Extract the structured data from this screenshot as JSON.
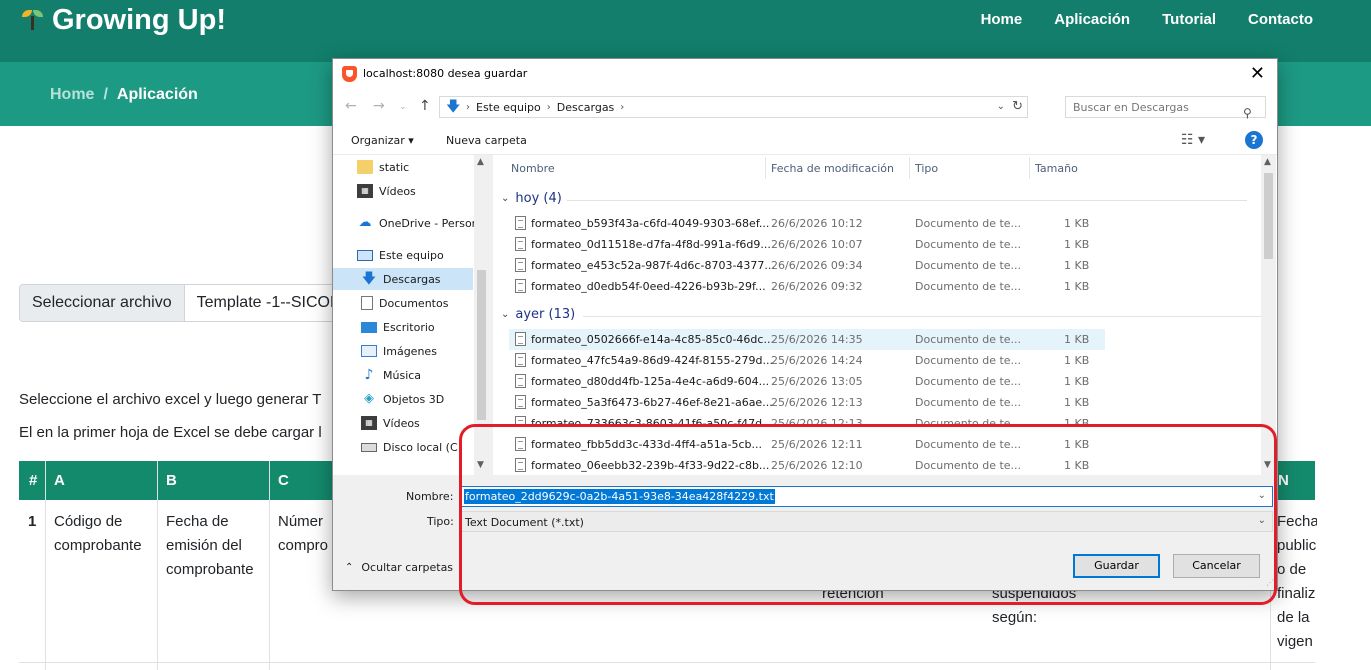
{
  "site": {
    "brand": "Growing Up!",
    "nav": [
      "Home",
      "Aplicación",
      "Tutorial",
      "Contacto"
    ],
    "breadcrumb": {
      "home": "Home",
      "separator": "/",
      "current": "Aplicación"
    },
    "file_input": {
      "button": "Seleccionar archivo",
      "filename": "Template -1--SICOR"
    },
    "instructions": [
      "Seleccione el archivo excel y luego generar T",
      "El en la primer hoja de Excel se debe cargar l"
    ],
    "table": {
      "headers": [
        "#",
        "A",
        "B",
        "C",
        "N"
      ],
      "row_number": "1",
      "cells": {
        "a": "Código de\ncomprobante",
        "b": "Fecha de\nemisión del\ncomprobante",
        "c": "Númer\ncompro",
        "retention": "retención",
        "suspended": "suspendidos\nsegún:",
        "n": "Fecha\npublic\no de\nfinaliz\nde la\nvigen"
      }
    }
  },
  "dialog": {
    "title": "localhost:8080 desea guardar",
    "address": [
      "Este equipo",
      "Descargas"
    ],
    "search_placeholder": "Buscar en Descargas",
    "toolbar": {
      "organize": "Organizar ▾",
      "new_folder": "Nueva carpeta"
    },
    "nav_items": [
      {
        "label": "static",
        "icon": "folder-icon"
      },
      {
        "label": "Vídeos",
        "icon": "videos-icon"
      },
      {
        "label": "OneDrive - Person",
        "icon": "onedrive-icon"
      },
      {
        "label": "Este equipo",
        "icon": "computer-icon"
      },
      {
        "label": "Descargas",
        "icon": "downloads-icon"
      },
      {
        "label": "Documentos",
        "icon": "documents-icon"
      },
      {
        "label": "Escritorio",
        "icon": "desktop-icon"
      },
      {
        "label": "Imágenes",
        "icon": "pictures-icon"
      },
      {
        "label": "Música",
        "icon": "music-icon"
      },
      {
        "label": "Objetos 3D",
        "icon": "objects3d-icon"
      },
      {
        "label": "Vídeos",
        "icon": "videos-icon"
      },
      {
        "label": "Disco local (C",
        "icon": "drive-icon"
      }
    ],
    "columns": [
      "Nombre",
      "Fecha de modificación",
      "Tipo",
      "Tamaño"
    ],
    "groups": [
      {
        "label": "hoy (4)",
        "files": [
          {
            "name": "formateo_b593f43a-c6fd-4049-9303-68ef...",
            "date": "26/6/2026 10:12",
            "type": "Documento de te...",
            "size": "1 KB"
          },
          {
            "name": "formateo_0d11518e-d7fa-4f8d-991a-f6d9...",
            "date": "26/6/2026 10:07",
            "type": "Documento de te...",
            "size": "1 KB"
          },
          {
            "name": "formateo_e453c52a-987f-4d6c-8703-4377...",
            "date": "26/6/2026 09:34",
            "type": "Documento de te...",
            "size": "1 KB"
          },
          {
            "name": "formateo_d0edb54f-0eed-4226-b93b-29f...",
            "date": "26/6/2026 09:32",
            "type": "Documento de te...",
            "size": "1 KB"
          }
        ]
      },
      {
        "label": "ayer (13)",
        "files": [
          {
            "name": "formateo_0502666f-e14a-4c85-85c0-46dc...",
            "date": "25/6/2026 14:35",
            "type": "Documento de te...",
            "size": "1 KB"
          },
          {
            "name": "formateo_47fc54a9-86d9-424f-8155-279d...",
            "date": "25/6/2026 14:24",
            "type": "Documento de te...",
            "size": "1 KB"
          },
          {
            "name": "formateo_d80dd4fb-125a-4e4c-a6d9-604...",
            "date": "25/6/2026 13:05",
            "type": "Documento de te...",
            "size": "1 KB"
          },
          {
            "name": "formateo_5a3f6473-6b27-46ef-8e21-a6ae...",
            "date": "25/6/2026 12:13",
            "type": "Documento de te...",
            "size": "1 KB"
          },
          {
            "name": "formateo_733663c3-8603-41f6-a50c-f47d...",
            "date": "25/6/2026 12:13",
            "type": "Documento de te...",
            "size": "1 KB"
          },
          {
            "name": "formateo_fbb5dd3c-433d-4ff4-a51a-5cb...",
            "date": "25/6/2026 12:11",
            "type": "Documento de te...",
            "size": "1 KB"
          },
          {
            "name": "formateo_06eebb32-239b-4f33-9d22-c8b...",
            "date": "25/6/2026 12:10",
            "type": "Documento de te...",
            "size": "1 KB"
          }
        ]
      }
    ],
    "filename_label": "Nombre:",
    "filename_value": "formateo_2dd9629c-0a2b-4a51-93e8-34ea428f4229.txt",
    "type_label": "Tipo:",
    "type_value": "Text Document (*.txt)",
    "hide_folders": "Ocultar carpetas",
    "save": "Guardar",
    "cancel": "Cancelar"
  },
  "colors": {
    "header_green": "#127e6b",
    "crumb_green": "#1d9a84",
    "table_header": "#148a6c",
    "highlight_red": "#e21d2a",
    "selection_blue": "#0078d7"
  }
}
